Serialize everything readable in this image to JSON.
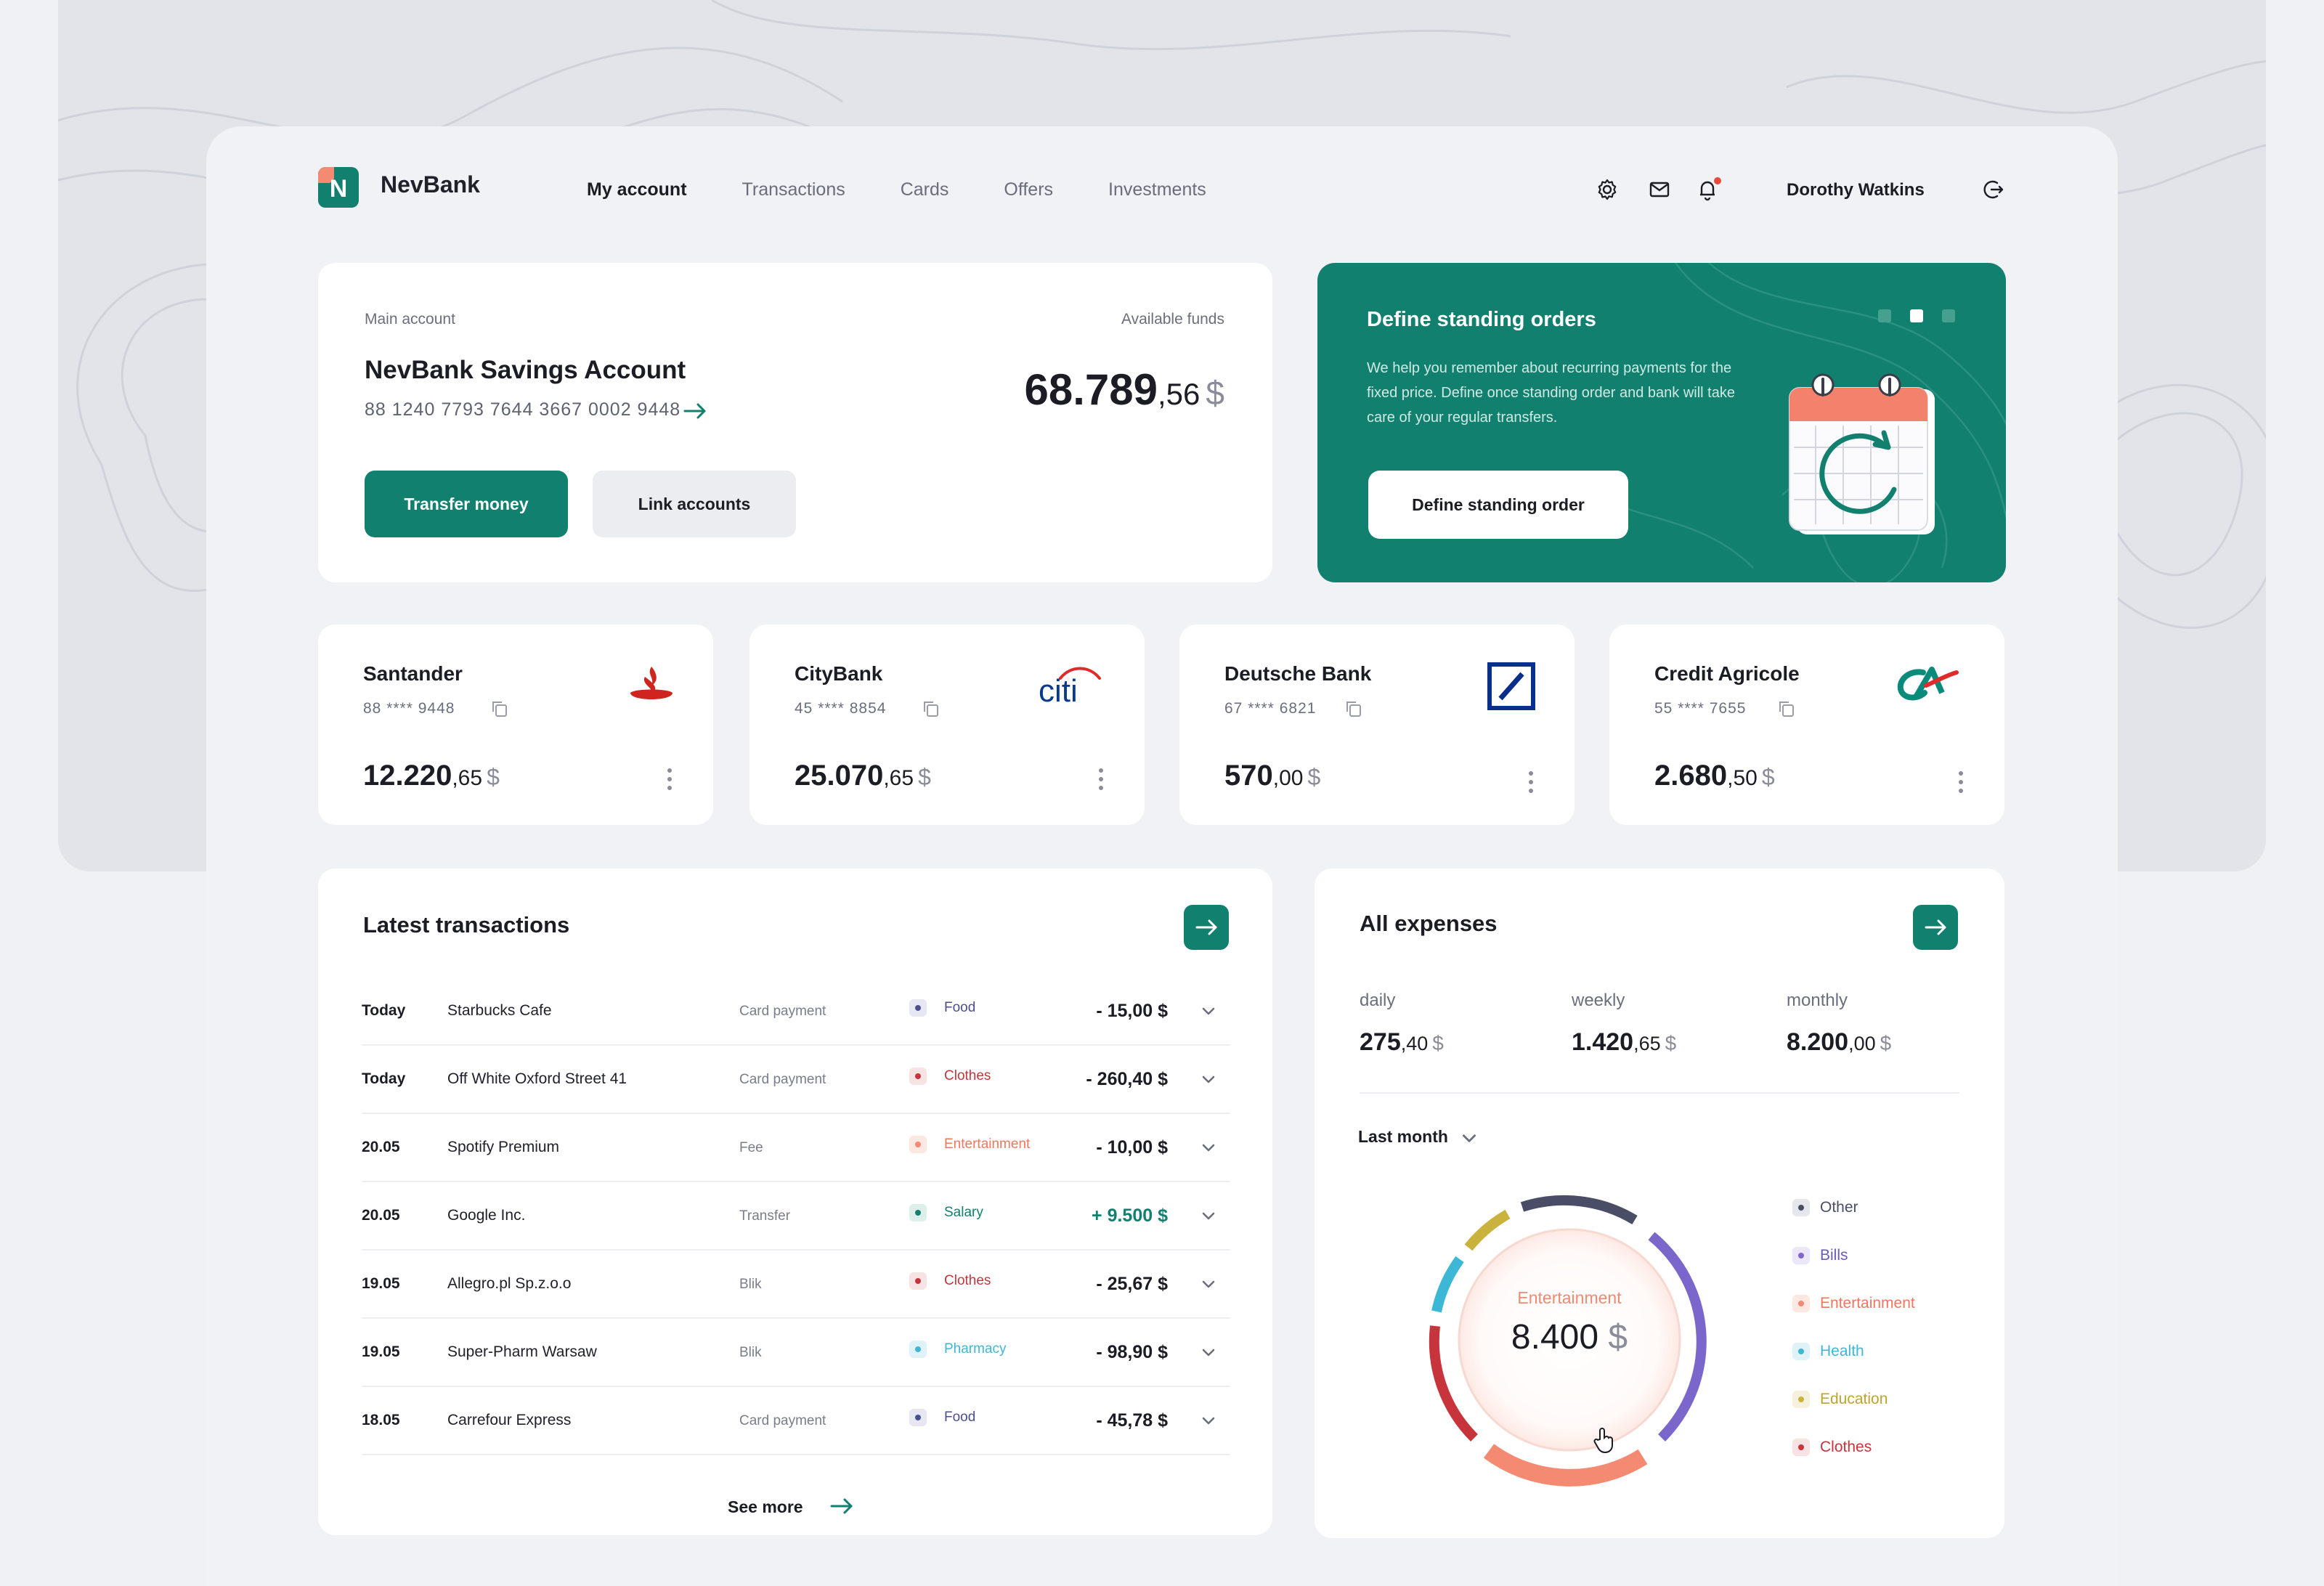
{
  "app": {
    "brand": "NevBank",
    "logo_letter": "N",
    "nav": [
      "My account",
      "Transactions",
      "Cards",
      "Offers",
      "Investments"
    ],
    "user_name": "Dorothy Watkins"
  },
  "main_account": {
    "label": "Main account",
    "funds_label": "Available funds",
    "title": "NevBank Savings Account",
    "number": "88 1240 7793 7644 3667 0002 9448",
    "amount_int": "68.789",
    "amount_cents": ",56",
    "currency": "$",
    "transfer_button": "Transfer money",
    "link_button": "Link accounts"
  },
  "promo": {
    "title": "Define standing orders",
    "text": "We help you remember about recurring payments for the fixed price. Define once standing order and bank will take care of your regular transfers.",
    "button": "Define standing order",
    "active_slide": 2
  },
  "banks": [
    {
      "name": "Santander",
      "number": "88 **** 9448",
      "balance_int": "12.220",
      "balance_cents": ",65",
      "currency": "$",
      "logo": "santander-flame-icon"
    },
    {
      "name": "CityBank",
      "number": "45 **** 8854",
      "balance_int": "25.070",
      "balance_cents": ",65",
      "currency": "$",
      "logo": "citi-logo"
    },
    {
      "name": "Deutsche Bank",
      "number": "67 **** 6821",
      "balance_int": "570",
      "balance_cents": ",00",
      "currency": "$",
      "logo": "deutsche-bank-logo"
    },
    {
      "name": "Credit Agricole",
      "number": "55 **** 7655",
      "balance_int": "2.680",
      "balance_cents": ",50",
      "currency": "$",
      "logo": "credit-agricole-logo"
    }
  ],
  "transactions": {
    "title": "Latest transactions",
    "see_more": "See more",
    "rows": [
      {
        "date": "Today",
        "name": "Starbucks Cafe",
        "type": "Card payment",
        "category": "Food",
        "amount": "- 15,00 $"
      },
      {
        "date": "Today",
        "name": "Off White Oxford Street 41",
        "type": "Card payment",
        "category": "Clothes",
        "amount": "- 260,40 $"
      },
      {
        "date": "20.05",
        "name": "Spotify Premium",
        "type": "Fee",
        "category": "Entertainment",
        "amount": "- 10,00 $"
      },
      {
        "date": "20.05",
        "name": "Google Inc.",
        "type": "Transfer",
        "category": "Salary",
        "amount": "+ 9.500 $"
      },
      {
        "date": "19.05",
        "name": "Allegro.pl Sp.z.o.o",
        "type": "Blik",
        "category": "Clothes",
        "amount": "- 25,67 $"
      },
      {
        "date": "19.05",
        "name": "Super-Pharm Warsaw",
        "type": "Blik",
        "category": "Pharmacy",
        "amount": "- 98,90 $"
      },
      {
        "date": "18.05",
        "name": "Carrefour Express",
        "type": "Card payment",
        "category": "Food",
        "amount": "- 45,78 $"
      }
    ]
  },
  "category_colors": {
    "Food": "#4b4e8f",
    "Clothes": "#c8343c",
    "Entertainment": "#f58a73",
    "Salary": "#12806f",
    "Pharmacy": "#3cb8d6",
    "Other": "#4a4d66",
    "Bills": "#7b66cc",
    "Health": "#3cb8d6",
    "Education": "#c9b33c"
  },
  "expenses": {
    "title": "All expenses",
    "daily_label": "daily",
    "daily_int": "275",
    "daily_cents": ",40",
    "weekly_label": "weekly",
    "weekly_int": "1.420",
    "weekly_cents": ",65",
    "monthly_label": "monthly",
    "monthly_int": "8.200",
    "monthly_cents": ",00",
    "currency": "$",
    "period": "Last month",
    "center_label": "Entertainment",
    "center_value": "8.400",
    "legend": [
      "Other",
      "Bills",
      "Entertainment",
      "Health",
      "Education",
      "Clothes"
    ]
  }
}
